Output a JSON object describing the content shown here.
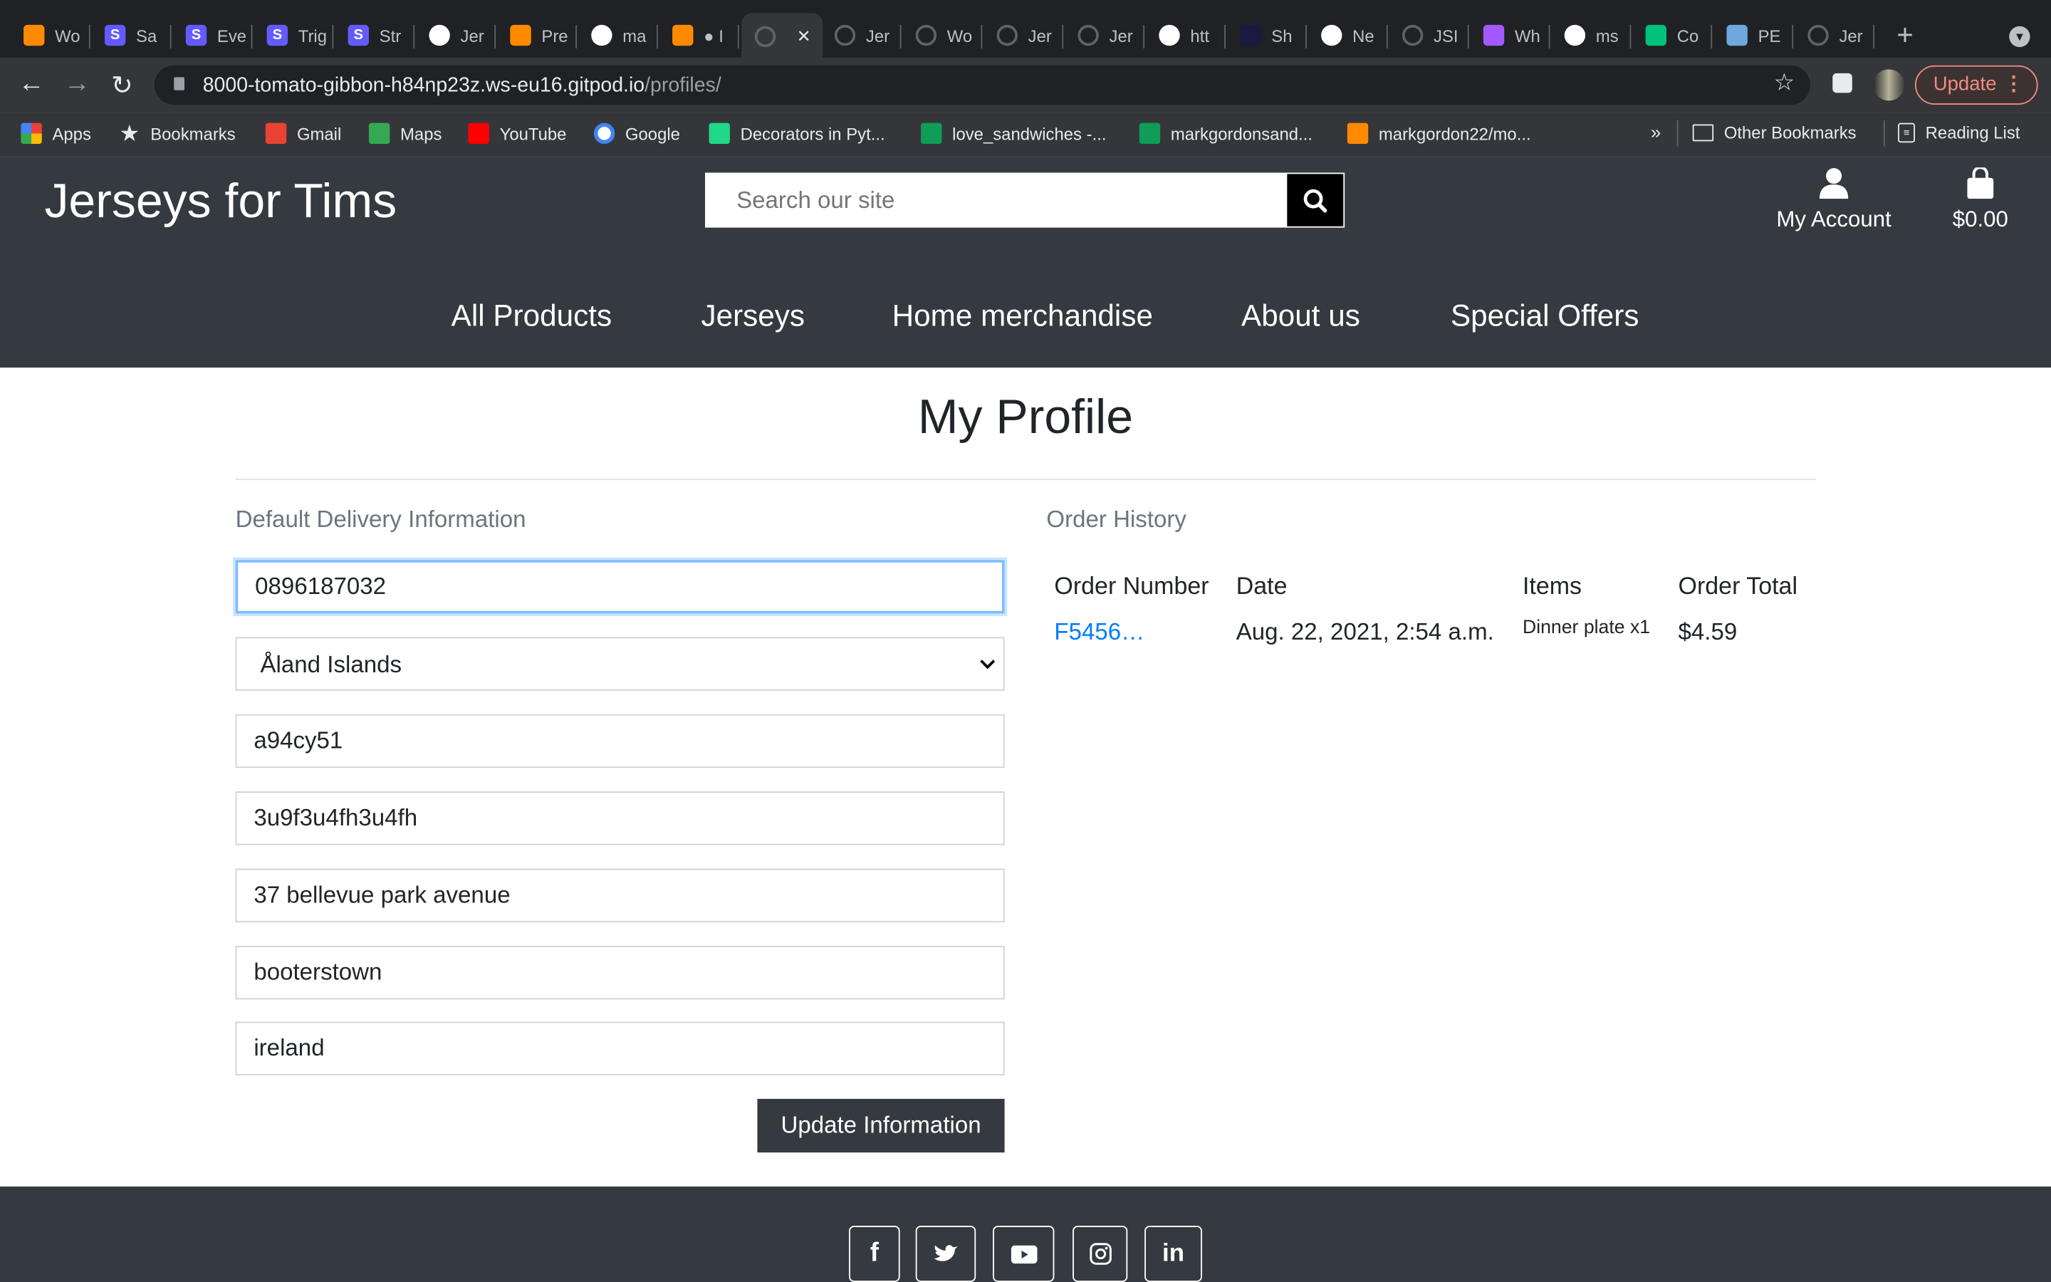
{
  "browser": {
    "tabs": [
      {
        "title": "Wo",
        "icon": "gitpod-icon",
        "color": "#ff8a00"
      },
      {
        "title": "Sa",
        "icon": "stripe-icon",
        "color": "#635bff"
      },
      {
        "title": "Eve",
        "icon": "stripe-icon",
        "color": "#635bff"
      },
      {
        "title": "Trig",
        "icon": "stripe-icon",
        "color": "#635bff"
      },
      {
        "title": "Str",
        "icon": "stripe-icon",
        "color": "#635bff"
      },
      {
        "title": "Jer",
        "icon": "github-icon",
        "color": "#ffffff"
      },
      {
        "title": "Pre",
        "icon": "gitpod-icon",
        "color": "#ff8a00"
      },
      {
        "title": "ma",
        "icon": "github-icon",
        "color": "#ffffff"
      },
      {
        "title": "● I",
        "icon": "gitpod-icon",
        "color": "#ff8a00"
      },
      {
        "title": "",
        "icon": "globe-icon",
        "color": "#5f6368",
        "active": true
      },
      {
        "title": "Jer",
        "icon": "globe-icon",
        "color": "#5f6368"
      },
      {
        "title": "Wo",
        "icon": "globe-icon",
        "color": "#5f6368"
      },
      {
        "title": "Jer",
        "icon": "globe-icon",
        "color": "#5f6368"
      },
      {
        "title": "Jer",
        "icon": "globe-icon",
        "color": "#5f6368"
      },
      {
        "title": "htt",
        "icon": "google-icon",
        "color": "#ffffff"
      },
      {
        "title": "Sh",
        "icon": "nu-icon",
        "color": "#1a1a40"
      },
      {
        "title": "Ne",
        "icon": "smiley-icon",
        "color": "#ffffff"
      },
      {
        "title": "JSI",
        "icon": "globe-icon",
        "color": "#5f6368"
      },
      {
        "title": "Wh",
        "icon": "figma-icon",
        "color": "#a259ff"
      },
      {
        "title": "ms",
        "icon": "github-icon",
        "color": "#ffffff"
      },
      {
        "title": "Co",
        "icon": "codeanywhere-icon",
        "color": "#00c27a"
      },
      {
        "title": "PE",
        "icon": "pep8-icon",
        "color": "#6fa8dc"
      },
      {
        "title": "Jer",
        "icon": "globe-icon",
        "color": "#5f6368"
      }
    ],
    "url_host": "8000-tomato-gibbon-h84np23z.ws-eu16.gitpod.io",
    "url_path": "/profiles/",
    "update_label": "Update",
    "bookmarks": [
      {
        "label": "Apps",
        "icon": "apps-grid-icon"
      },
      {
        "label": "Bookmarks",
        "icon": "star-icon"
      },
      {
        "label": "Gmail",
        "icon": "gmail-icon"
      },
      {
        "label": "Maps",
        "icon": "maps-icon"
      },
      {
        "label": "YouTube",
        "icon": "youtube-icon"
      },
      {
        "label": "Google",
        "icon": "google-icon"
      },
      {
        "label": "Decorators in Pyt...",
        "icon": "pycharm-icon"
      },
      {
        "label": "love_sandwiches -...",
        "icon": "sheets-icon"
      },
      {
        "label": "markgordonsand...",
        "icon": "sheets-icon"
      },
      {
        "label": "markgordon22/mo...",
        "icon": "gitpod-icon"
      }
    ],
    "overflow_label": "»",
    "other_bookmarks": "Other Bookmarks",
    "reading_list": "Reading List"
  },
  "site": {
    "brand": "Jerseys for Tims",
    "search_placeholder": "Search our site",
    "account_label": "My Account",
    "cart_total": "$0.00",
    "nav": [
      "All Products",
      "Jerseys",
      "Home merchandise",
      "About us",
      "Special Offers"
    ]
  },
  "profile": {
    "title": "My Profile",
    "delivery_heading": "Default Delivery Information",
    "phone": "0896187032",
    "country": "Åland Islands",
    "postcode": "a94cy51",
    "town": "3u9f3u4fh3u4fh",
    "street1": "37 bellevue park avenue",
    "street2": "booterstown",
    "county": "ireland",
    "update_button": "Update Information"
  },
  "orders": {
    "heading": "Order History",
    "columns": [
      "Order Number",
      "Date",
      "Items",
      "Order Total"
    ],
    "rows": [
      {
        "number": "F5456…",
        "date": "Aug. 22, 2021, 2:54 a.m.",
        "items": "Dinner plate x1",
        "total": "$4.59"
      }
    ]
  },
  "footer": {
    "social": [
      "facebook-icon",
      "twitter-icon",
      "youtube-icon",
      "instagram-icon",
      "linkedin-icon"
    ]
  },
  "colors": {
    "header_bg": "#353a40",
    "link": "#007bff",
    "focus_border": "#80bdff"
  }
}
